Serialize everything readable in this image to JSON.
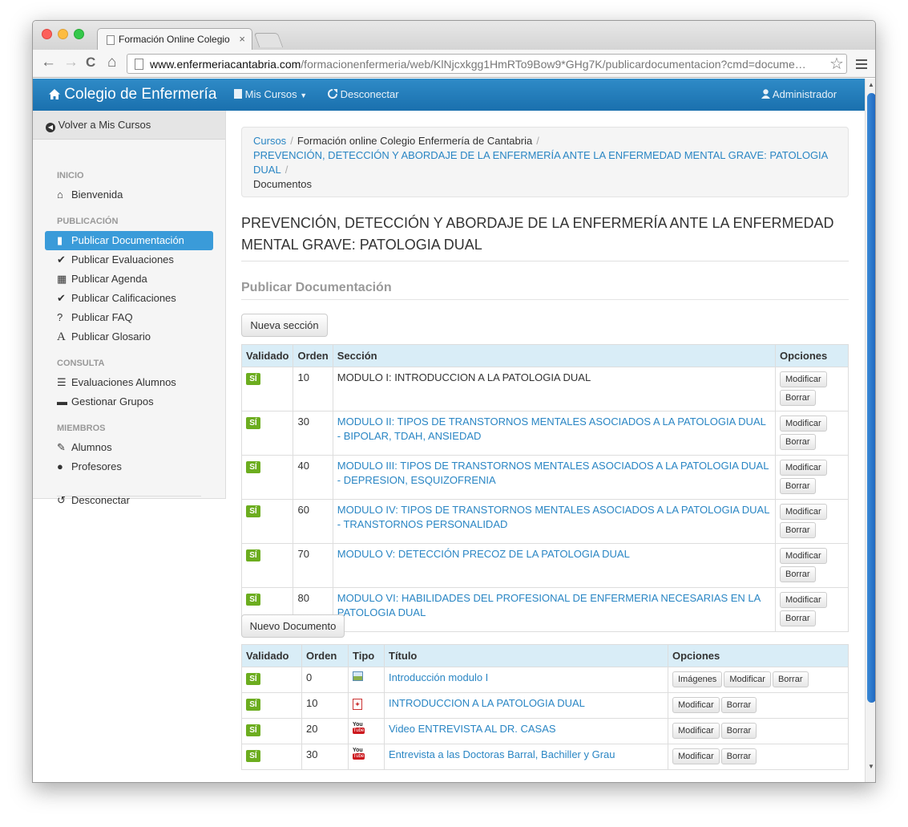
{
  "browser": {
    "tab_title": "Formación Online Colegio",
    "tab_close": "×",
    "url_host": "www.enfermeriacantabria.com",
    "url_path": "/formacionenfermeria/web/KlNjcxkgg1HmRTo9Bow9*GHg7K/publicardocumentacion?cmd=docume…",
    "back": "←",
    "forward": "→",
    "reload": "C",
    "home": "⌂",
    "bookmark": "☆"
  },
  "navbar": {
    "brand": "Colegio de Enfermería",
    "brand_icon": "home-icon",
    "mis_cursos": "Mis Cursos",
    "desconectar": "Desconectar",
    "admin": "Administrador"
  },
  "sidebar": {
    "back": "Volver a Mis Cursos",
    "sections": {
      "inicio": {
        "header": "INICIO",
        "items": [
          {
            "label": "Bienvenida",
            "icon": "home-icon"
          }
        ]
      },
      "publicacion": {
        "header": "PUBLICACIÓN",
        "items": [
          {
            "label": "Publicar Documentación",
            "icon": "file-icon"
          },
          {
            "label": "Publicar Evaluaciones",
            "icon": "check-icon"
          },
          {
            "label": "Publicar Agenda",
            "icon": "calendar-icon"
          },
          {
            "label": "Publicar Calificaciones",
            "icon": "check-icon"
          },
          {
            "label": "Publicar FAQ",
            "icon": "question-icon"
          },
          {
            "label": "Publicar Glosario",
            "icon": "font-icon"
          }
        ]
      },
      "consulta": {
        "header": "CONSULTA",
        "items": [
          {
            "label": "Evaluaciones Alumnos",
            "icon": "list-icon"
          },
          {
            "label": "Gestionar Grupos",
            "icon": "briefcase-icon"
          }
        ]
      },
      "miembros": {
        "header": "MIEMBROS",
        "items": [
          {
            "label": "Alumnos",
            "icon": "pencil-icon"
          },
          {
            "label": "Profesores",
            "icon": "user-icon"
          }
        ]
      }
    },
    "logout": "Desconectar"
  },
  "breadcrumb": {
    "cursos": "Cursos",
    "formacion": "Formación online Colegio Enfermería de Cantabria",
    "curso": "PREVENCIÓN, DETECCIÓN Y ABORDAJE DE LA ENFERMERÍA ANTE LA ENFERMEDAD MENTAL GRAVE: PATOLOGIA DUAL",
    "current": "Documentos",
    "sep": "/"
  },
  "page": {
    "title": "PREVENCIÓN, DETECCIÓN Y ABORDAJE DE LA ENFERMERÍA ANTE LA ENFERMEDAD MENTAL GRAVE: PATOLOGIA DUAL",
    "subtitle": "Publicar Documentación"
  },
  "secciones": {
    "new_button": "Nueva sección",
    "headers": {
      "validado": "Validado",
      "orden": "Orden",
      "seccion": "Sección",
      "opciones": "Opciones"
    },
    "rows": [
      {
        "validado": "SÍ",
        "orden": "10",
        "seccion": "MODULO I: INTRODUCCION A LA PATOLOGIA DUAL"
      },
      {
        "validado": "SÍ",
        "orden": "30",
        "seccion": "MODULO II: TIPOS DE TRANSTORNOS MENTALES ASOCIADOS A LA PATOLOGIA DUAL - BIPOLAR, TDAH, ANSIEDAD"
      },
      {
        "validado": "SÍ",
        "orden": "40",
        "seccion": "MODULO III: TIPOS DE TRANSTORNOS MENTALES ASOCIADOS A LA PATOLOGIA DUAL - DEPRESION, ESQUIZOFRENIA"
      },
      {
        "validado": "SÍ",
        "orden": "60",
        "seccion": "MODULO IV: TIPOS DE TRANSTORNOS MENTALES ASOCIADOS A LA PATOLOGIA DUAL - TRANSTORNOS PERSONALIDAD"
      },
      {
        "validado": "SÍ",
        "orden": "70",
        "seccion": "MODULO V: DETECCIÓN PRECOZ DE LA PATOLOGIA DUAL"
      },
      {
        "validado": "SÍ",
        "orden": "80",
        "seccion": "MODULO VI: HABILIDADES DEL PROFESIONAL DE ENFERMERIA NECESARIAS EN LA PATOLOGIA DUAL"
      }
    ],
    "modificar": "Modificar",
    "borrar": "Borrar"
  },
  "documentos": {
    "new_button": "Nuevo Documento",
    "headers": {
      "validado": "Validado",
      "orden": "Orden",
      "tipo": "Tipo",
      "titulo": "Título",
      "opciones": "Opciones"
    },
    "rows": [
      {
        "validado": "SÍ",
        "orden": "0",
        "tipo": "gallery-icon",
        "titulo": "Introducción modulo I",
        "imagenes": "Imágenes"
      },
      {
        "validado": "SÍ",
        "orden": "10",
        "tipo": "pdf-icon",
        "titulo": "INTRODUCCION A LA PATOLOGIA DUAL"
      },
      {
        "validado": "SÍ",
        "orden": "20",
        "tipo": "youtube-icon",
        "titulo": "Video ENTREVISTA AL DR. CASAS"
      },
      {
        "validado": "SÍ",
        "orden": "30",
        "tipo": "youtube-icon",
        "titulo": "Entrevista a las Doctoras Barral, Bachiller y Grau"
      }
    ],
    "modificar": "Modificar",
    "borrar": "Borrar",
    "youtube_top": "You",
    "youtube_bottom": "Tube"
  },
  "colors": {
    "navbar": "#1a70ae",
    "active": "#3a9bd9",
    "badge": "#6cad1f",
    "link": "#2a86c4",
    "table_header": "#d9edf7"
  }
}
